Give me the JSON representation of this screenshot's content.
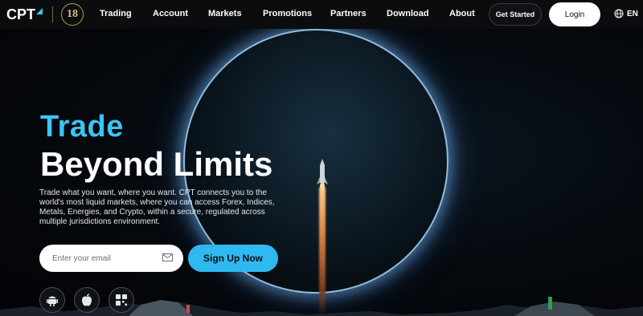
{
  "header": {
    "logo_text": "CPT",
    "badge_text": "18",
    "nav": [
      "Trading",
      "Account",
      "Markets",
      "Promotions",
      "Partners",
      "Download",
      "About"
    ],
    "get_started": "Get Started",
    "login": "Login",
    "language": "EN"
  },
  "hero": {
    "title_line1": "Trade",
    "title_line2": "Beyond Limits",
    "description": "Trade what you want, where you want. CPT connects you to the world's most liquid markets, where you can access Forex, Indices, Metals, Energies, and Crypto, within a secure, regulated across multiple jurisdictions environment.",
    "email_placeholder": "Enter your email",
    "signup_label": "Sign Up Now"
  },
  "app_icons": [
    "android-icon",
    "apple-icon",
    "qr-code-icon"
  ],
  "colors": {
    "accent": "#3cc4f4",
    "signup_button": "#2fb9f0",
    "header_bg": "#0b0c0e",
    "badge_gold": "#d9bf74"
  },
  "icons": {
    "mail": "mail-icon",
    "globe": "globe-icon",
    "logo_mark": "cpt-logo-icon"
  }
}
